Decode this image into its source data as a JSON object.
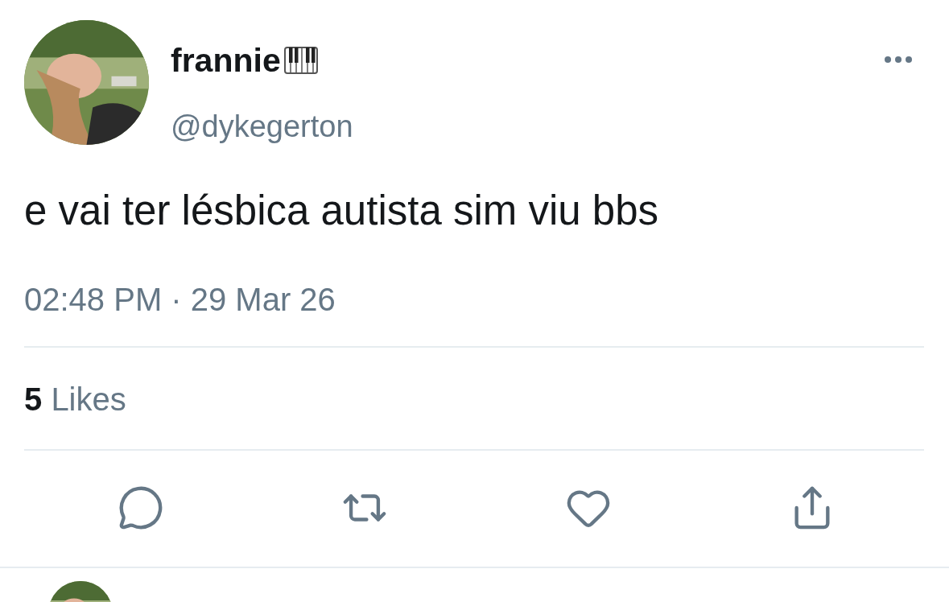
{
  "tweet": {
    "author": {
      "name": "frannie",
      "handle": "@dykegerton"
    },
    "text": "e vai ter lésbica autista sim viu bbs",
    "timestamp": "02:48 PM · 29 Mar 26",
    "likes": {
      "count": "5",
      "label": "Likes"
    }
  },
  "actions": [
    {
      "kind": "reply"
    },
    {
      "kind": "retweet"
    },
    {
      "kind": "like"
    },
    {
      "kind": "share"
    }
  ]
}
